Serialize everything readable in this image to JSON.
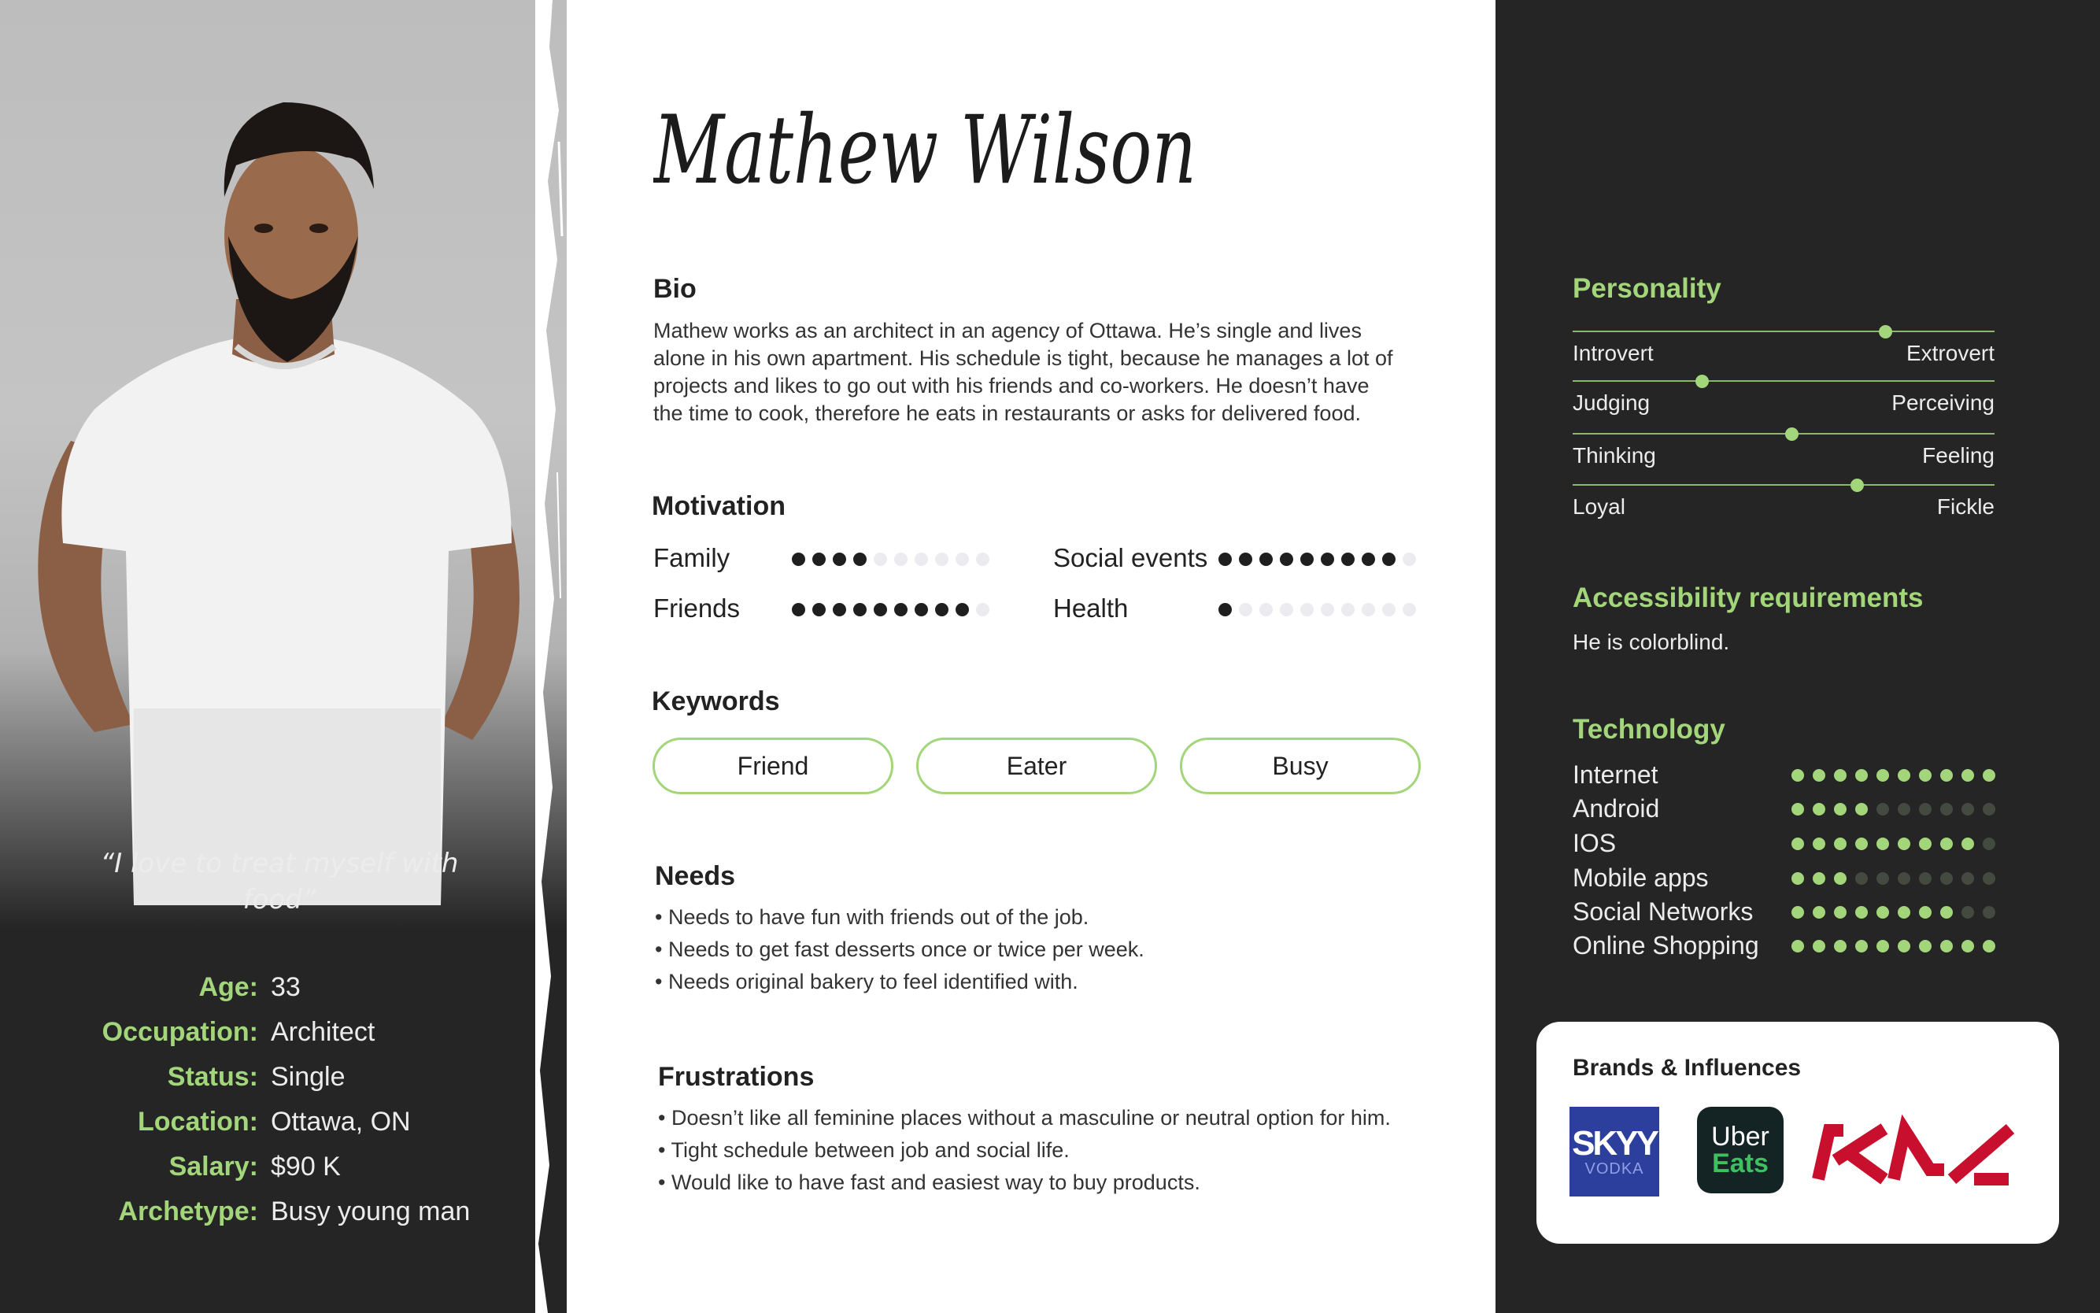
{
  "persona": {
    "name": "Mathew Wilson",
    "quote": "“I love to treat myself with food”",
    "details": [
      {
        "label": "Age:",
        "value": "33"
      },
      {
        "label": "Occupation:",
        "value": "Architect"
      },
      {
        "label": "Status:",
        "value": "Single"
      },
      {
        "label": "Location:",
        "value": "Ottawa, ON"
      },
      {
        "label": "Salary:",
        "value": "$90 K"
      },
      {
        "label": "Archetype:",
        "value": "Busy young man"
      }
    ]
  },
  "bio": {
    "title": "Bio",
    "lines": [
      "Mathew works as an architect in an agency of Ottawa. He’s single and lives",
      "alone in his own apartment. His schedule is tight, because he manages a lot of",
      "projects and likes to go out with his friends and co-workers. He doesn’t have",
      "the time to cook, therefore he eats in restaurants or asks for delivered food."
    ]
  },
  "motivation": {
    "title": "Motivation",
    "max": 10,
    "items": [
      {
        "label": "Family",
        "value": 4
      },
      {
        "label": "Social events",
        "value": 9
      },
      {
        "label": "Friends",
        "value": 9
      },
      {
        "label": "Health",
        "value": 1
      }
    ]
  },
  "keywords": {
    "title": "Keywords",
    "items": [
      "Friend",
      "Eater",
      "Busy"
    ]
  },
  "needs": {
    "title": "Needs",
    "items": [
      "• Needs to have fun with friends out of the job.",
      "• Needs to get fast desserts once or twice per week.",
      "• Needs original bakery to feel identified with."
    ]
  },
  "frustrations": {
    "title": "Frustrations",
    "items": [
      "• Doesn’t like all feminine places without a masculine or neutral option for him.",
      "• Tight schedule between job and social life.",
      "• Would like to have fast and easiest way to buy products."
    ]
  },
  "personality": {
    "title": "Personality",
    "traits": [
      {
        "left": "Introvert",
        "right": "Extrovert",
        "value": 0.75
      },
      {
        "left": "Judging",
        "right": "Perceiving",
        "value": 0.3
      },
      {
        "left": "Thinking",
        "right": "Feeling",
        "value": 0.52
      },
      {
        "left": "Loyal",
        "right": "Fickle",
        "value": 0.68
      }
    ]
  },
  "accessibility": {
    "title": "Accessibility requirements",
    "text": "He is colorblind."
  },
  "technology": {
    "title": "Technology",
    "max": 10,
    "items": [
      {
        "label": "Internet",
        "value": 10
      },
      {
        "label": "Android",
        "value": 4
      },
      {
        "label": "IOS",
        "value": 9
      },
      {
        "label": "Mobile apps",
        "value": 3
      },
      {
        "label": "Social Networks",
        "value": 8
      },
      {
        "label": "Online Shopping",
        "value": 10
      }
    ]
  },
  "brands": {
    "title": "Brands & Influences",
    "logos": [
      {
        "name": "skyy-vodka-logo",
        "line1": "SKYY",
        "line2": "VODKA"
      },
      {
        "name": "uber-eats-logo",
        "line1": "Uber",
        "line2": "Eats"
      },
      {
        "name": "kia-logo",
        "line1": "KIA"
      }
    ]
  },
  "colors": {
    "accent": "#a3d67b",
    "dark_panel": "#252525",
    "brand_skyy": "#2d3f9c",
    "brand_uber_bg": "#142323",
    "brand_uber_green": "#3fc060",
    "brand_kia": "#c8102e"
  }
}
